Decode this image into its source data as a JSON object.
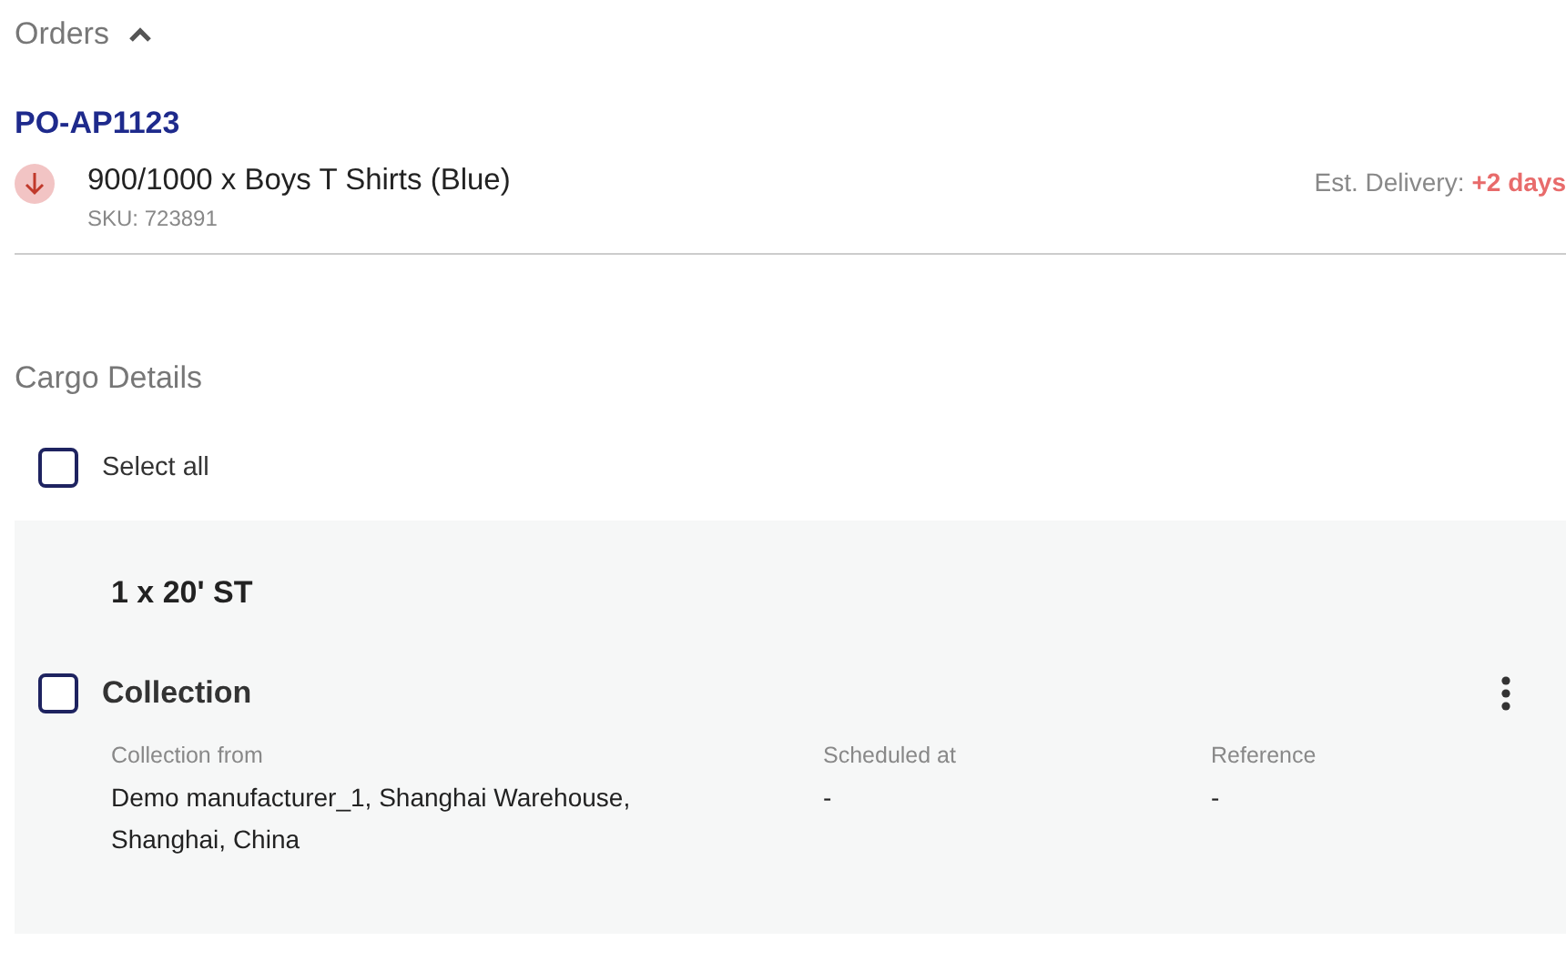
{
  "section": {
    "title": "Orders",
    "expanded": true
  },
  "order": {
    "number": "PO-AP1123",
    "item": "900/1000 x Boys T Shirts (Blue)",
    "sku": "SKU: 723891",
    "delivery_label": "Est. Delivery:",
    "delivery_value": "+2 days"
  },
  "cargo": {
    "title": "Cargo Details",
    "select_all": {
      "label": "Select all",
      "checked": false
    },
    "containers": [
      {
        "title": "1 x 20' ST",
        "legs": [
          {
            "title": "Collection",
            "checked": false,
            "fields": [
              {
                "label": "Collection from",
                "value": "Demo manufacturer_1, Shanghai Warehouse, Shanghai, China"
              },
              {
                "label": "Scheduled at",
                "value": "-"
              },
              {
                "label": "Reference",
                "value": "-"
              }
            ]
          }
        ]
      }
    ]
  }
}
